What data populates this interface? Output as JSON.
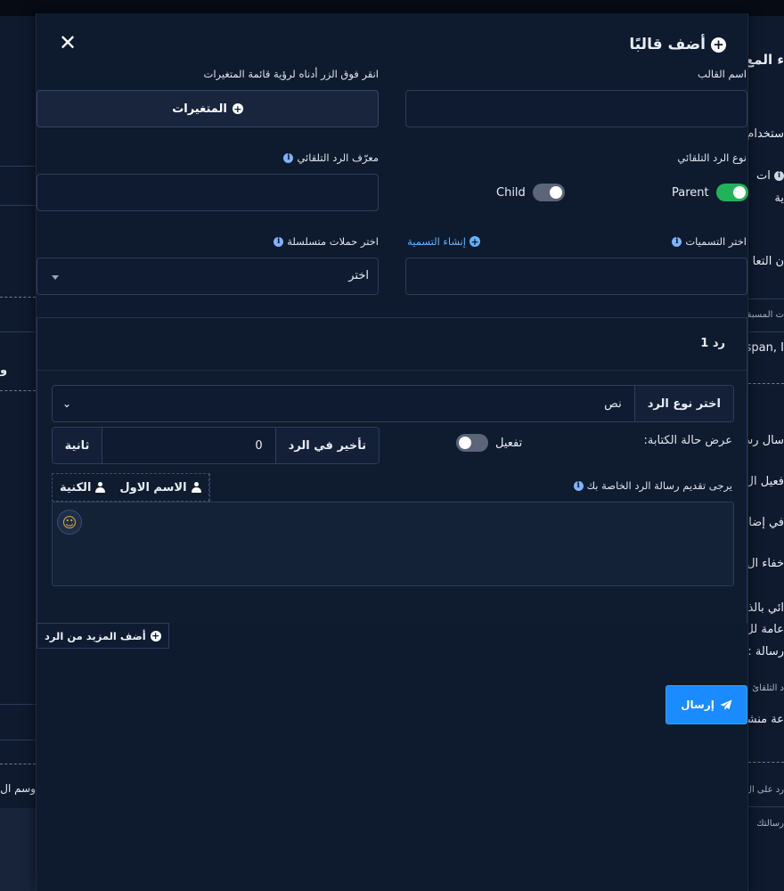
{
  "modal": {
    "title": "أضف قالبًا",
    "close_glyph": "✕"
  },
  "template_name": {
    "label": "اسم القالب",
    "value": ""
  },
  "variables": {
    "hint": "انقر فوق الزر أدناه لرؤية قائمة المتغيرات",
    "button_label": "المتغيرات"
  },
  "autoreply_type": {
    "label": "نوع الرد التلقائي",
    "options": [
      {
        "label": "Parent",
        "checked": true
      },
      {
        "label": "Child",
        "checked": false
      }
    ]
  },
  "autoreply_id": {
    "label": "معرّف الرد التلقائي",
    "value": ""
  },
  "labels_select": {
    "label": "اختر التسميات",
    "create_link": "إنشاء التسمية",
    "value": ""
  },
  "sequence_campaigns": {
    "label": "اختر حملات متسلسلة",
    "selected": "اختر"
  },
  "reply": {
    "title": "رد 1",
    "type_label": "اختر نوع الرد",
    "type_value": "نص",
    "typing_label": "عرض حالة الكتابة:",
    "typing_toggle_label": "تفعيل",
    "typing_enabled": false,
    "delay_label": "تأخير في الرد",
    "delay_value": "0",
    "delay_unit": "ثانية",
    "message_hint": "يرجى تقديم رسالة الرد الخاصة بك",
    "var_first_name": "الاسم الاول",
    "var_last_name": "الكنية",
    "message_value": ""
  },
  "add_more_label": "أضف المزيد من الرد",
  "send_label": "إرسال",
  "background": {
    "frag_title": "ء المع",
    "frag_use": "ستخدام",
    "frag_t": "ات",
    "frag_ya": "ية",
    "frag_taal": "ن التعا",
    "frag_musbaqa": "ت المسبقة",
    "frag_span": "span, I",
    "frag_rsal": "سال رس",
    "frag_tafeel": "فعيل ال",
    "frag_fi": "في إضا",
    "frag_ikhfa": "خفاء ال",
    "frag_ai": "ائي بالذ",
    "frag_ama": "عامة لل",
    "frag_risala": "رسالة :",
    "frag_tlqai": "د التلقائ",
    "frag_mansh": "عة منشو",
    "frag_rad": "رد على ال",
    "frag_risalatk": "رسالتك",
    "frag_left_w": "و",
    "frag_left_wsm": "وسم ال"
  }
}
